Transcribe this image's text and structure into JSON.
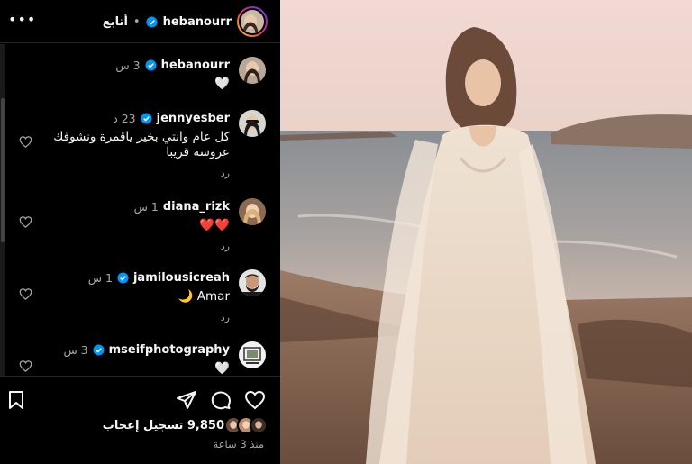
{
  "post_header": {
    "username": "hebanourr",
    "separator": "•",
    "follow_label": "أتابع",
    "more_icon": "•••"
  },
  "comments": [
    {
      "username": "hebanourr",
      "time": "3 س",
      "text": "🤍",
      "reply_label": "",
      "verified": true,
      "avatar": "woman-dark-hair"
    },
    {
      "username": "jennyesber",
      "time": "23 د",
      "text": "كل عام وانتي بخير ياقمرة ونشوفك عروسة قريبا",
      "reply_label": "رد",
      "verified": true,
      "avatar": "woman-sunglasses"
    },
    {
      "username": "diana_rizk",
      "time": "1 س",
      "text": "❤️❤️",
      "reply_label": "رد",
      "verified": false,
      "avatar": "woman-blonde"
    },
    {
      "username": "jamilousicreah",
      "time": "1 س",
      "text": "Amar 🌙",
      "reply_label": "رد",
      "verified": true,
      "avatar": "man-beard"
    },
    {
      "username": "mseifphotography",
      "time": "3 س",
      "text": "🤍",
      "reply_label": "",
      "verified": true,
      "avatar": "logo-frame"
    }
  ],
  "footer": {
    "likes_count": "9,850",
    "likes_label": "تسجيل إعجاب",
    "posted_time": "منذ 3 ساعة"
  },
  "icons": {
    "like": "heart-icon",
    "comment": "comment-icon",
    "share": "share-icon",
    "save": "bookmark-icon",
    "verified": "verified-badge-icon"
  },
  "colors": {
    "background": "#000000",
    "text": "#f5f5f5",
    "secondary_text": "#a8a8a8",
    "verified": "#0095f6",
    "divider": "#262626"
  }
}
